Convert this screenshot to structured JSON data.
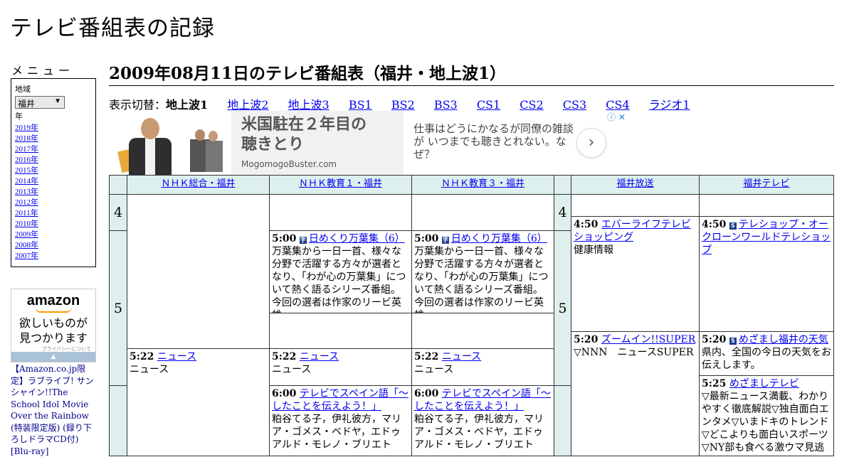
{
  "site": {
    "title": "テレビ番組表の記録"
  },
  "sidebar": {
    "menu_heading": "メニュー",
    "region_label": "地域",
    "region_value": "福井",
    "year_label": "年",
    "years": [
      "2019年",
      "2018年",
      "2017年",
      "2016年",
      "2015年",
      "2014年",
      "2013年",
      "2012年",
      "2011年",
      "2010年",
      "2009年",
      "2008年",
      "2007年"
    ]
  },
  "ad_amazon": {
    "logo": "amazon",
    "tagline_1": "欲しいものが",
    "tagline_2": "見つかります",
    "privacy": "プライバシーについて",
    "product_text": "【Amazon.co.jp限定】ラブライブ! サンシャイン!!The School Idol Movie Over the Rainbow (特装限定版) (録り下ろしドラマCD付) [Blu-ray]"
  },
  "main": {
    "heading": "2009年08月11日のテレビ番組表（福井・地上波1）",
    "switch_label": "表示切替：",
    "current_view": "地上波1",
    "views": [
      "地上波2",
      "地上波3",
      "BS1",
      "BS2",
      "BS3",
      "CS1",
      "CS2",
      "CS3",
      "CS4",
      "ラジオ1"
    ]
  },
  "banner": {
    "headline_1": "米国駐在２年目の",
    "headline_2": "聴きとり",
    "source": "MogomogoBuster.com",
    "desc": "仕事はどうにかなるが同僚の雑談が いつまでも聴きとれない。なぜ？",
    "cta_icon": "chevron-right-icon",
    "adchoice_icon": "info-close-icon"
  },
  "schedule": {
    "channels": [
      "ＮＨＫ総合・福井",
      "ＮＨＫ教育１・福井",
      "ＮＨＫ教育３・福井",
      "福井放送",
      "福井テレビ"
    ],
    "hours": [
      "4",
      "5",
      "4",
      "5"
    ],
    "programs": {
      "e1_500": {
        "time": "5:00",
        "title": "日めくり万葉集（6）",
        "desc": "万葉集から一日一首、様々な分野で活躍する方々が選者となり、「わが心の万葉集」について熱く語るシリーズ番組。今回の選者は作家のリービ英雄。"
      },
      "e3_500": {
        "time": "5:00",
        "title": "日めくり万葉集（6）",
        "desc": "万葉集から一日一首、様々な分野で活躍する方々が選者となり、「わが心の万葉集」について熱く語るシリーズ番組。今回の選者は作家のリービ英雄。"
      },
      "g_522": {
        "time": "5:22",
        "title": "ニュース",
        "desc": "ニュース"
      },
      "e1_522": {
        "time": "5:22",
        "title": "ニュース",
        "desc": "ニュース"
      },
      "e3_522": {
        "time": "5:22",
        "title": "ニュース",
        "desc": "ニュース"
      },
      "e1_600": {
        "time": "6:00",
        "title": "テレビでスペイン語「～したことを伝えよう！」",
        "desc": "粕谷てる子，伊礼彼方，マリア・ゴメス・ベドヤ，エドゥアルド・モレノ・ブリエト"
      },
      "e3_600": {
        "time": "6:00",
        "title": "テレビでスペイン語「～したことを伝えよう！」",
        "desc": "粕谷てる子，伊礼彼方，マリア・ゴメス・ベドヤ，エドゥアルド・モレノ・ブリエト"
      },
      "fbc_450": {
        "time": "4:50",
        "title": "エバーライフテレビショッピング",
        "desc": "健康情報"
      },
      "fbc_520": {
        "time": "5:20",
        "title": "ズームイン!!SUPER",
        "desc": "▽NNN　ニュースSUPER"
      },
      "ftv_450": {
        "time": "4:50",
        "mark": "S",
        "title": "テレショップ・オークローンワールドテレショップ",
        "desc": ""
      },
      "ftv_520": {
        "time": "5:20",
        "mark": "S",
        "title": "めざまし福井の天気",
        "desc": "県内、全国の今日の天気をお伝えします。"
      },
      "ftv_525": {
        "time": "5:25",
        "title": "めざましテレビ",
        "desc": "▽最新ニュース満載、わかりやすく徹底解説▽独自面白エンタメ▽いまドキのトレンド▽どこよりも面白いスポーツ▽NY部も食べる激ウマ見逃せ"
      }
    },
    "mark_e1": "字",
    "mark_e3": "字"
  }
}
